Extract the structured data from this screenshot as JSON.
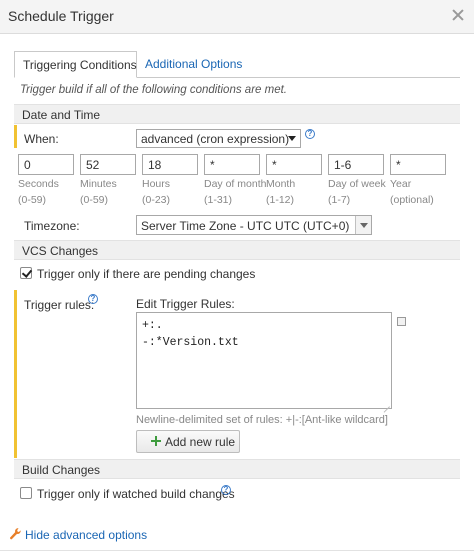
{
  "dialog": {
    "title": "Schedule Trigger"
  },
  "tabs": [
    {
      "label": "Triggering Conditions",
      "active": true
    },
    {
      "label": "Additional Options",
      "active": false
    }
  ],
  "subtitle": "Trigger build if all of the following conditions are met.",
  "date_time": {
    "section": "Date and Time",
    "when_label": "When:",
    "when_value": "advanced (cron expression)",
    "cron": [
      {
        "value": "0",
        "name": "Seconds",
        "range": "(0-59)"
      },
      {
        "value": "52",
        "name": "Minutes",
        "range": "(0-59)"
      },
      {
        "value": "18",
        "name": "Hours",
        "range": "(0-23)"
      },
      {
        "value": "*",
        "name": "Day of month",
        "range": "(1-31)"
      },
      {
        "value": "*",
        "name": "Month",
        "range": "(1-12)"
      },
      {
        "value": "1-6",
        "name": "Day of week",
        "range": "(1-7)"
      },
      {
        "value": "*",
        "name": "Year",
        "range": "(optional)"
      }
    ],
    "timezone_label": "Timezone:",
    "timezone_value": "Server Time Zone - UTC UTC (UTC+0)"
  },
  "vcs": {
    "section": "VCS Changes",
    "pending_label": "Trigger only if there are pending changes",
    "pending_checked": true,
    "rules_label": "Trigger rules:",
    "edit_label": "Edit Trigger Rules:",
    "rules_text": "+:.\n-:*Version.txt",
    "rules_hint": "Newline-delimited set of rules: +|-:[Ant-like wildcard]",
    "add_rule_label": "Add new rule"
  },
  "build_changes": {
    "section": "Build Changes",
    "watched_label": "Trigger only if watched build changes",
    "watched_checked": false
  },
  "advanced_link": "Hide advanced options",
  "colors": {
    "accent_yellow": "#f1c232",
    "link_blue": "#1a66b4",
    "add_green": "#3d9b3d"
  }
}
